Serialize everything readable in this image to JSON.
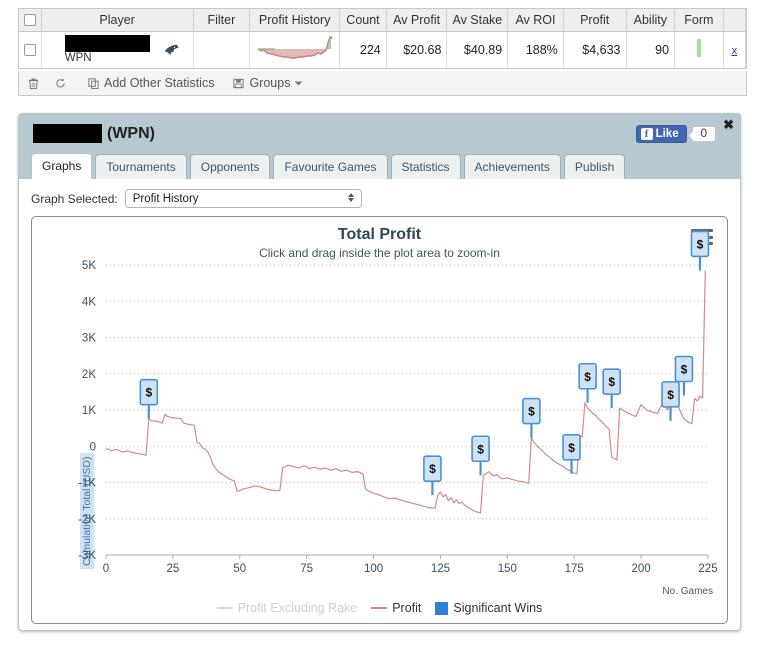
{
  "table": {
    "columns": [
      "",
      "Player",
      "Filter",
      "Profit History",
      "Count",
      "Av Profit",
      "Av Stake",
      "Av ROI",
      "Profit",
      "Ability",
      "Form",
      ""
    ],
    "row": {
      "player_name": "",
      "player_site": "WPN",
      "filter": "",
      "count": "224",
      "av_profit": "$20.68",
      "av_stake": "$40.89",
      "av_roi": "188%",
      "profit": "$4,633",
      "ability": "90",
      "remove_label": "x"
    }
  },
  "toolbar": {
    "delete_label": "",
    "refresh_label": "",
    "add_stats_label": "Add Other Statistics",
    "groups_label": "Groups"
  },
  "panel": {
    "player_name": "",
    "site": "(WPN)",
    "close_label": "✖",
    "facebook": {
      "f_glyph": "f",
      "like_label": "Like",
      "count": "0"
    },
    "tabs": [
      {
        "label": "Graphs",
        "active": true
      },
      {
        "label": "Tournaments",
        "active": false
      },
      {
        "label": "Opponents",
        "active": false
      },
      {
        "label": "Favourite Games",
        "active": false
      },
      {
        "label": "Statistics",
        "active": false
      },
      {
        "label": "Achievements",
        "active": false
      },
      {
        "label": "Publish",
        "active": false
      }
    ],
    "graph_select": {
      "label": "Graph Selected:",
      "value": "Profit History",
      "options": [
        "Profit History"
      ]
    }
  },
  "colors": {
    "profit_line": "#d68a8a",
    "excl_rake_line": "#d8d8d8",
    "significant_wins": "#2f7fd8",
    "marker_fill": "#cfe2f3",
    "marker_stroke": "#4a90d9",
    "panel_header": "#b6c8d0",
    "title": "#2f4858"
  },
  "chart_data": {
    "type": "line",
    "title": "Total Profit",
    "subtitle": "Click and drag inside the plot area to zoom-in",
    "xlabel": "No. Games",
    "ylabel": "Cumulative Total (USD)",
    "xlim": [
      0,
      225
    ],
    "ylim": [
      -3000,
      5000
    ],
    "xticks": [
      0,
      25,
      50,
      75,
      100,
      125,
      150,
      175,
      200,
      225
    ],
    "xticklabels": [
      "0",
      "25",
      "50",
      "75",
      "100",
      "125",
      "150",
      "175",
      "200",
      "225"
    ],
    "yticks": [
      -3000,
      -2000,
      -1000,
      0,
      1000,
      2000,
      3000,
      4000,
      5000
    ],
    "yticklabels": [
      "-3K",
      "-2K",
      "-1K",
      "0",
      "1K",
      "2K",
      "3K",
      "4K",
      "5K"
    ],
    "grid": true,
    "legend_position": "bottom-center",
    "legend": [
      {
        "name": "Profit Excluding Rake",
        "type": "line",
        "color": "#d8d8d8"
      },
      {
        "name": "Profit",
        "type": "line",
        "color": "#d68a8a"
      },
      {
        "name": "Significant Wins",
        "type": "square",
        "color": "#2f7fd8"
      }
    ],
    "series": [
      {
        "name": "Profit",
        "color": "#d68a8a",
        "x": [
          0,
          2,
          4,
          6,
          8,
          10,
          12,
          14,
          15,
          16,
          17,
          19,
          21,
          22,
          23,
          24,
          25,
          26,
          27,
          28,
          29,
          30,
          31,
          33,
          34,
          35,
          36,
          37,
          38,
          39,
          40,
          41,
          42,
          44,
          46,
          48,
          49,
          50,
          51,
          52,
          54,
          56,
          58,
          60,
          62,
          64,
          65,
          66,
          67,
          68,
          70,
          72,
          74,
          75,
          76,
          78,
          80,
          82,
          84,
          86,
          88,
          90,
          92,
          94,
          96,
          97,
          98,
          99,
          100,
          101,
          102,
          104,
          106,
          108,
          110,
          112,
          114,
          116,
          118,
          119,
          120,
          121,
          122,
          123,
          124,
          125,
          126,
          127,
          128,
          129,
          130,
          131,
          132,
          133,
          134,
          135,
          136,
          137,
          138,
          139,
          140,
          141,
          142,
          143,
          144,
          145,
          146,
          147,
          148,
          150,
          152,
          154,
          156,
          157,
          158,
          159,
          160,
          161,
          162,
          163,
          164,
          165,
          166,
          167,
          168,
          169,
          170,
          171,
          172,
          173,
          174,
          175,
          176,
          177,
          178,
          179,
          180,
          181,
          182,
          183,
          184,
          185,
          186,
          187,
          188,
          189,
          190,
          191,
          192,
          194,
          196,
          198,
          200,
          202,
          204,
          206,
          208,
          210,
          211,
          212,
          213,
          214,
          215,
          216,
          217,
          218,
          219,
          220,
          221,
          222,
          223,
          224
        ],
        "y": [
          -60,
          -120,
          -90,
          -160,
          -130,
          -175,
          -200,
          -230,
          -250,
          760,
          700,
          690,
          640,
          880,
          820,
          800,
          790,
          780,
          770,
          760,
          640,
          620,
          600,
          580,
          110,
          80,
          -40,
          -80,
          -150,
          -300,
          -500,
          -620,
          -700,
          -800,
          -900,
          -960,
          -1240,
          -1230,
          -1180,
          -1170,
          -1130,
          -1090,
          -1130,
          -1180,
          -1210,
          -1230,
          -1215,
          -600,
          -560,
          -520,
          -560,
          -600,
          -540,
          -560,
          -620,
          -580,
          -630,
          -600,
          -660,
          -620,
          -690,
          -660,
          -720,
          -700,
          -760,
          -1180,
          -1230,
          -1260,
          -1300,
          -1320,
          -1340,
          -1400,
          -1450,
          -1430,
          -1480,
          -1520,
          -1560,
          -1600,
          -1640,
          -1660,
          -1680,
          -1690,
          -1700,
          -1710,
          -1350,
          -1260,
          -1400,
          -1330,
          -1500,
          -1420,
          -1560,
          -1480,
          -1580,
          -1540,
          -1620,
          -1680,
          -1720,
          -1760,
          -1800,
          -1820,
          -1840,
          -800,
          -760,
          -700,
          -760,
          -820,
          -780,
          -850,
          -900,
          -870,
          -920,
          -960,
          -980,
          -1000,
          -1020,
          240,
          100,
          20,
          -50,
          -120,
          -200,
          -260,
          -320,
          -380,
          -440,
          -480,
          -520,
          -560,
          -620,
          -660,
          -700,
          -740,
          -760,
          300,
          260,
          1200,
          1050,
          980,
          900,
          850,
          760,
          700,
          620,
          540,
          480,
          -300,
          -340,
          -380,
          1050,
          960,
          880,
          820,
          1150,
          1000,
          950,
          900,
          1180,
          1000,
          1400,
          1380,
          1200,
          1100,
          900,
          760,
          700,
          650,
          630,
          1320,
          1250,
          1380,
          1340,
          4850,
          4680,
          4600
        ]
      },
      {
        "name": "Profit Excluding Rake",
        "color": "#d8d8d8",
        "x": [],
        "y": []
      }
    ],
    "significant_wins": [
      {
        "x": 16,
        "y": 760,
        "label": "$"
      },
      {
        "x": 122,
        "y": -1350,
        "label": "$"
      },
      {
        "x": 140,
        "y": -800,
        "label": "$"
      },
      {
        "x": 159,
        "y": 240,
        "label": "$"
      },
      {
        "x": 174,
        "y": -760,
        "label": "$"
      },
      {
        "x": 180,
        "y": 1200,
        "label": "$"
      },
      {
        "x": 189,
        "y": 1050,
        "label": "$"
      },
      {
        "x": 211,
        "y": 700,
        "label": "$"
      },
      {
        "x": 216,
        "y": 1400,
        "label": "$"
      },
      {
        "x": 222,
        "y": 4850,
        "label": "$"
      }
    ]
  }
}
